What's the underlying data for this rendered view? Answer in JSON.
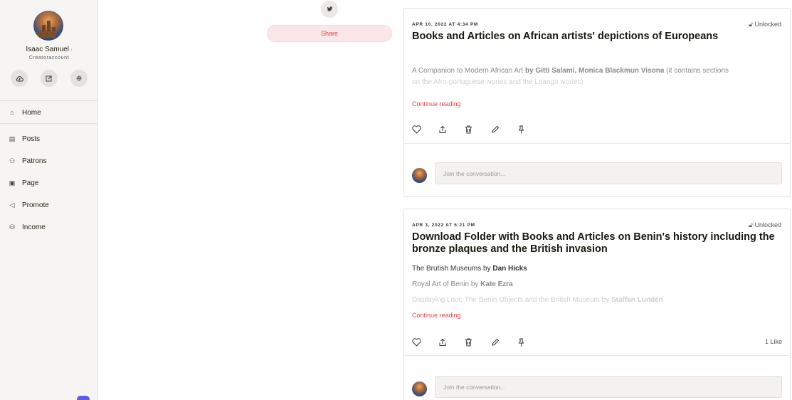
{
  "user": {
    "name": "Isaac Samuel",
    "sub": "Creatoraccount"
  },
  "sidebar": {
    "icons": [
      "cloud-upload-icon",
      "edit-icon",
      "gear-icon"
    ],
    "items": [
      {
        "label": "Home",
        "icon": "home-icon"
      },
      {
        "label": "Posts",
        "icon": "posts-icon"
      },
      {
        "label": "Patrons",
        "icon": "patrons-icon"
      },
      {
        "label": "Page",
        "icon": "page-icon"
      },
      {
        "label": "Promote",
        "icon": "promote-icon"
      },
      {
        "label": "Income",
        "icon": "income-icon"
      }
    ]
  },
  "share": {
    "label": "Share"
  },
  "posts": [
    {
      "date": "APR 10, 2022 AT 4:34 PM",
      "status": "Unlocked",
      "title": "Books and Articles on African artists' depictions of Europeans",
      "excerpt": {
        "l1a": "A Companion to Modern African Art ",
        "l1b": "by Gitti Salami, Monica Blackmun Visona",
        "l1c": " (it contains sections",
        "l2": "on the Afro-portuguese ivories and the Loango ivories)"
      },
      "continue": "Continue reading",
      "likes": "",
      "comment_placeholder": "Join the conversation..."
    },
    {
      "date": "APR 3, 2022 AT 5:21 PM",
      "status": "Unlocked",
      "title": "Download Folder with Books and Articles on Benin's history including the bronze plaques and the British invasion",
      "excerpt": {
        "l1a": "The Brutish Museums by ",
        "l1b": "Dan Hicks",
        "l2a": "Royal Art of Benin  by ",
        "l2b": "Kate Ezra",
        "l3a": "Displaying Loot: The Benin Objects and the British Museum by ",
        "l3b": "Staffan Lundén"
      },
      "continue": "Continue reading",
      "likes": "1 Like",
      "comment_placeholder": "Join the conversation..."
    }
  ],
  "colors": {
    "accent": "#e0454a",
    "sidebar_bg": "#f6f5f3",
    "share_bg": "#fbe7e7"
  }
}
